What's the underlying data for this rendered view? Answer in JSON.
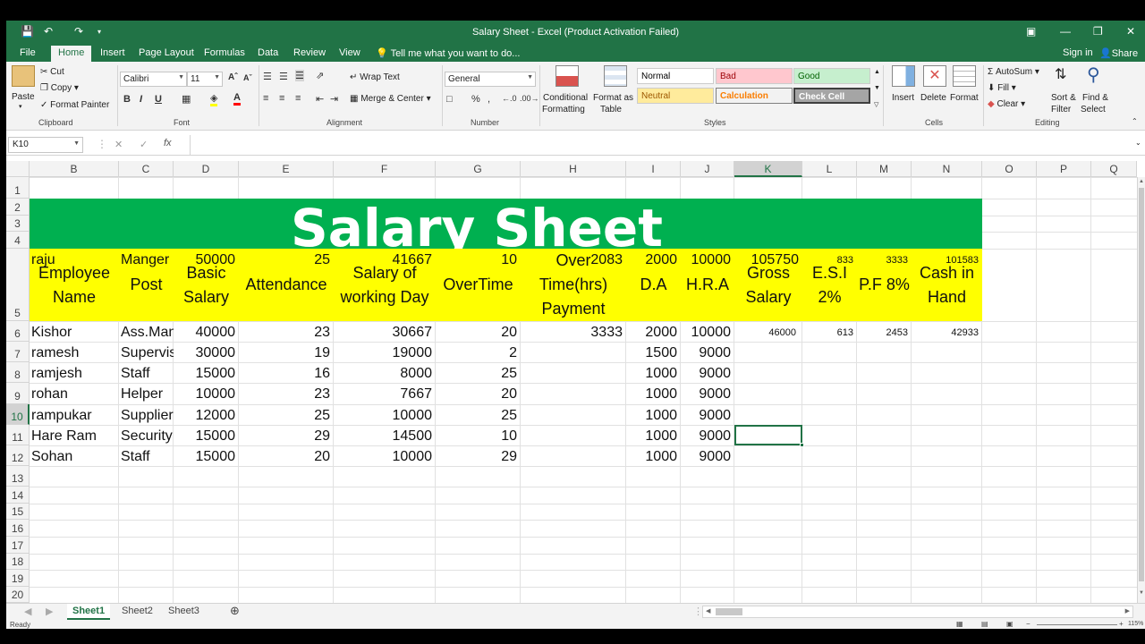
{
  "window": {
    "title": "Salary Sheet - Excel (Product Activation Failed)"
  },
  "ribbon_tabs": [
    "File",
    "Home",
    "Insert",
    "Page Layout",
    "Formulas",
    "Data",
    "Review",
    "View"
  ],
  "tell_me": "Tell me what you want to do...",
  "account": {
    "sign_in": "Sign in",
    "share": "Share"
  },
  "clipboard": {
    "paste": "Paste",
    "cut": "Cut",
    "copy": "Copy",
    "format_painter": "Format Painter",
    "label": "Clipboard"
  },
  "font": {
    "name": "Calibri",
    "size": "11",
    "label": "Font"
  },
  "alignment": {
    "wrap": "Wrap Text",
    "merge": "Merge & Center",
    "label": "Alignment"
  },
  "number": {
    "format": "General",
    "label": "Number"
  },
  "styles": {
    "conditional": [
      "Conditional",
      "Formatting"
    ],
    "format_table": [
      "Format as",
      "Table"
    ],
    "label": "Styles",
    "cells": [
      {
        "name": "Normal",
        "bg": "#ffffff",
        "fg": "#000000"
      },
      {
        "name": "Bad",
        "bg": "#ffc7ce",
        "fg": "#9c0006"
      },
      {
        "name": "Good",
        "bg": "#c6efce",
        "fg": "#006100"
      },
      {
        "name": "Neutral",
        "bg": "#ffeb9c",
        "fg": "#9c5700"
      },
      {
        "name": "Calculation",
        "bg": "#f2f2f2",
        "fg": "#fa7d00"
      },
      {
        "name": "Check Cell",
        "bg": "#a5a5a5",
        "fg": "#ffffff"
      }
    ]
  },
  "cells_group": {
    "insert": "Insert",
    "delete": "Delete",
    "format": "Format",
    "label": "Cells"
  },
  "editing": {
    "autosum": "AutoSum",
    "fill": "Fill",
    "clear": "Clear",
    "sort": [
      "Sort &",
      "Filter"
    ],
    "find": [
      "Find &",
      "Select"
    ],
    "label": "Editing"
  },
  "formula_bar": {
    "name_box": "K10",
    "content": ""
  },
  "columns": [
    "B",
    "C",
    "D",
    "E",
    "F",
    "G",
    "H",
    "I",
    "J",
    "K",
    "L",
    "M",
    "N",
    "O",
    "P",
    "Q"
  ],
  "rows": [
    "1",
    "2",
    "3",
    "4",
    "5",
    "6",
    "7",
    "8",
    "9",
    "10",
    "11",
    "12",
    "13",
    "14",
    "15",
    "16",
    "17",
    "18",
    "19",
    "20"
  ],
  "sheet_title": "Salary Sheet",
  "headers": [
    "Employee Name",
    "Post",
    "Basic Salary",
    "Attendance",
    "Salary of working Day",
    "OverTime",
    "Over Time(hrs) Payment",
    "D.A",
    "H.R.A",
    "Gross Salary",
    "E.S.I 2%",
    "P.F 8%",
    "Cash in Hand"
  ],
  "table": [
    [
      "raju",
      "Manger",
      "50000",
      "25",
      "41667",
      "10",
      "2083",
      "2000",
      "10000",
      "105750",
      "833",
      "3333",
      "101583"
    ],
    [
      "Kishor",
      "Ass.Manager",
      "40000",
      "23",
      "30667",
      "20",
      "3333",
      "2000",
      "10000",
      "46000",
      "613",
      "2453",
      "42933"
    ],
    [
      "ramesh",
      "Supervisor",
      "30000",
      "19",
      "19000",
      "2",
      "",
      "1500",
      "9000",
      "",
      "",
      "",
      ""
    ],
    [
      "ramjesh",
      "Staff",
      "15000",
      "16",
      "8000",
      "25",
      "",
      "1000",
      "9000",
      "",
      "",
      "",
      ""
    ],
    [
      "rohan",
      "Helper",
      "10000",
      "23",
      "7667",
      "20",
      "",
      "1000",
      "9000",
      "",
      "",
      "",
      ""
    ],
    [
      "rampukar",
      "Supplier",
      "12000",
      "25",
      "10000",
      "25",
      "",
      "1000",
      "9000",
      "",
      "",
      "",
      ""
    ],
    [
      "Hare Ram",
      "Security",
      "15000",
      "29",
      "14500",
      "10",
      "",
      "1000",
      "9000",
      "",
      "",
      "",
      ""
    ],
    [
      "Sohan",
      "Staff",
      "15000",
      "20",
      "10000",
      "29",
      "",
      "1000",
      "9000",
      "",
      "",
      "",
      ""
    ]
  ],
  "sheets": [
    "Sheet1",
    "Sheet2",
    "Sheet3"
  ],
  "status": {
    "text": "Ready",
    "zoom": "115%"
  },
  "colors": {
    "accent": "#217346",
    "title_fill": "#00b050",
    "header_fill": "#ffff00"
  }
}
